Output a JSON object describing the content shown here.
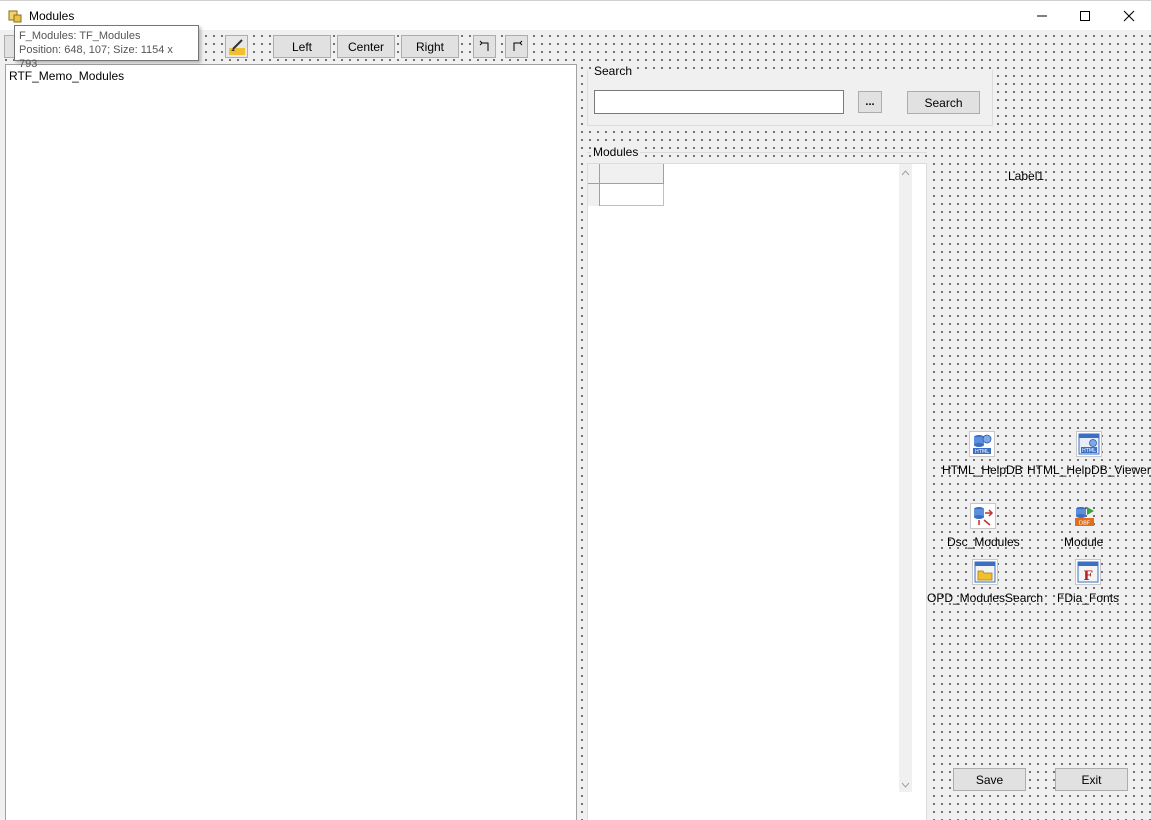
{
  "window": {
    "title": "Modules",
    "icons": {
      "app": "app-icon",
      "minimize": "minimize-icon",
      "maximize": "maximize-icon",
      "close": "close-icon"
    }
  },
  "hint": {
    "line1": "F_Modules: TF_Modules",
    "line2": "Position: 648, 107; Size: 1154 x 793"
  },
  "toolbar": {
    "highlight_icon": "highlight-icon",
    "left_label": "Left",
    "center_label": "Center",
    "right_label": "Right",
    "undo_icon": "undo-icon",
    "redo_icon": "redo-icon"
  },
  "memo": {
    "name": "RTF_Memo_Modules"
  },
  "search": {
    "group_title": "Search",
    "input_value": "",
    "ellipsis_label": "...",
    "button_label": "Search"
  },
  "modules": {
    "group_title": "Modules"
  },
  "label1": "Label1",
  "components": [
    {
      "label": "HTML_HelpDB",
      "icon": "html-helpdb-icon"
    },
    {
      "label": "HTML_HelpDB_Viewer",
      "icon": "html-viewer-icon"
    },
    {
      "label": "Dsc_Modules",
      "icon": "datasource-icon"
    },
    {
      "label": "Module",
      "icon": "dbf-table-icon"
    },
    {
      "label": "OPD_ModulesSearch",
      "icon": "open-dialog-icon"
    },
    {
      "label": "FDia_Fonts",
      "icon": "font-dialog-icon"
    }
  ],
  "buttons": {
    "save_label": "Save",
    "exit_label": "Exit"
  },
  "colors": {
    "accent": "#f0c030",
    "db_blue": "#3a6fc4",
    "dbf_orange": "#e07020"
  }
}
